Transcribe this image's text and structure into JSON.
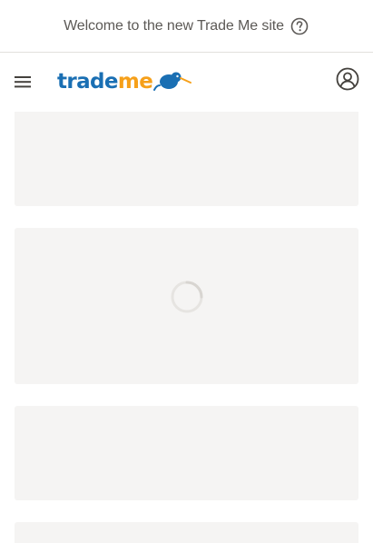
{
  "banner": {
    "text": "Welcome to the new Trade Me site",
    "help_icon": "question-circle-icon"
  },
  "header": {
    "menu_icon": "hamburger-menu-icon",
    "logo": {
      "part1": "trade",
      "part2": "me"
    },
    "account_icon": "user-account-icon"
  },
  "colors": {
    "brand_blue": "#1a6fb3",
    "brand_orange": "#f6a01a",
    "placeholder_bg": "#f5f4f3"
  },
  "loading": {
    "indicator": "loading-spinner"
  }
}
